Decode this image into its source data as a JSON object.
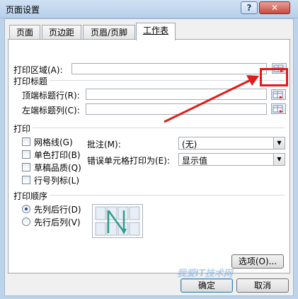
{
  "window": {
    "title": "页面设置",
    "help": "?",
    "close": "✕"
  },
  "tabs": [
    {
      "label": "页面"
    },
    {
      "label": "页边距"
    },
    {
      "label": "页眉/页脚"
    },
    {
      "label": "工作表"
    }
  ],
  "print_area": {
    "label": "打印区域(A):",
    "value": ""
  },
  "print_titles": {
    "heading": "打印标题",
    "top_rows": {
      "label": "顶端标题行(R):",
      "value": ""
    },
    "left_columns": {
      "label": "左端标题列(C):",
      "value": ""
    }
  },
  "print": {
    "heading": "打印",
    "gridlines": "网格线(G)",
    "black_white": "单色打印(B)",
    "draft": "草稿品质(Q)",
    "row_col_headers": "行号列标(L)",
    "comments_label": "批注(M):",
    "comments_value": "(无)",
    "errors_label": "错误单元格打印为(E):",
    "errors_value": "显示值"
  },
  "page_order": {
    "heading": "打印顺序",
    "down_then_over": "先列后行(D)",
    "over_then_down": "先行后列(V)"
  },
  "buttons": {
    "options": "选项(O)...",
    "ok": "确定",
    "cancel": "取消"
  },
  "watermark": "我爱IT技术网",
  "colors": {
    "highlight": "#e01b1b",
    "arrow": "#e01b1b"
  }
}
